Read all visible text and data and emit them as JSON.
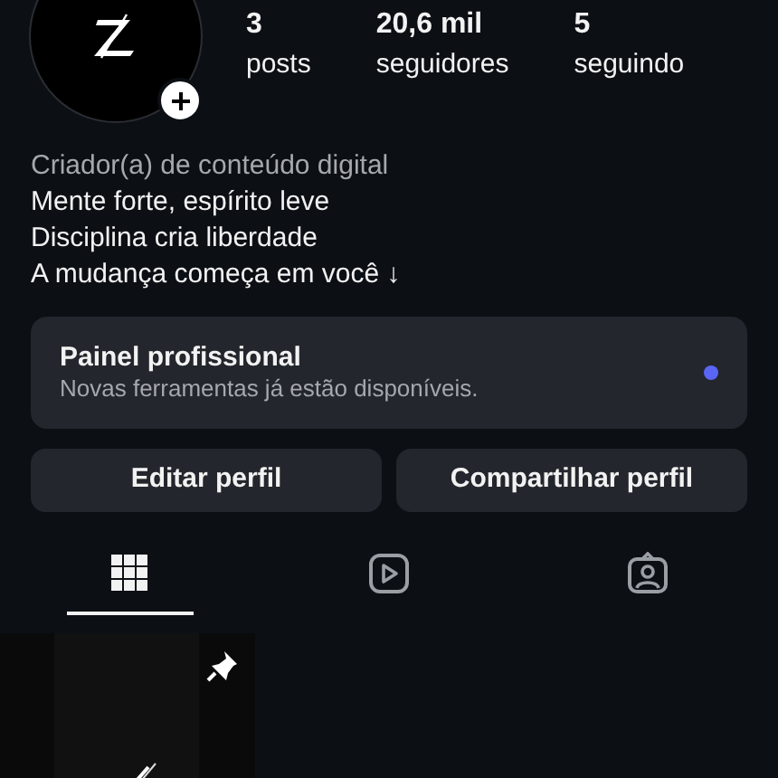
{
  "profile": {
    "stats": [
      {
        "value": "3",
        "label": "posts"
      },
      {
        "value": "20,6 mil",
        "label": "seguidores"
      },
      {
        "value": "5",
        "label": "seguindo"
      }
    ],
    "category": "Criador(a) de conteúdo digital",
    "bio": [
      "Mente forte, espírito leve",
      "Disciplina cria liberdade",
      "A mudança começa em você ↓"
    ]
  },
  "professional_panel": {
    "title": "Painel profissional",
    "subtitle": "Novas ferramentas já estão disponíveis.",
    "unread": true
  },
  "buttons": [
    "Editar perfil",
    "Compartilhar perfil"
  ],
  "tabs": [
    {
      "kind": "grid",
      "selected": true
    },
    {
      "kind": "reels",
      "selected": false
    },
    {
      "kind": "tagged",
      "selected": false
    }
  ],
  "posts": [
    {
      "kind": "picture",
      "pinned": true
    }
  ]
}
